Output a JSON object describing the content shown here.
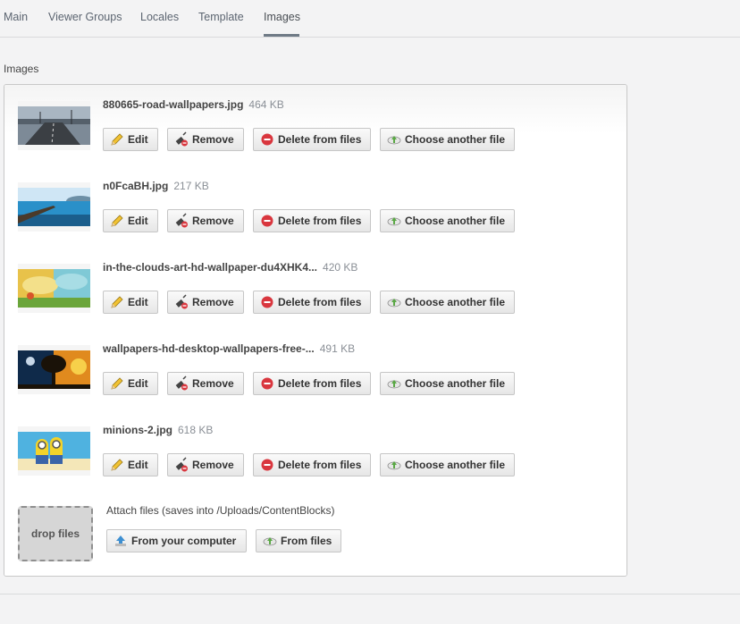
{
  "tabs": [
    {
      "label": "Main"
    },
    {
      "label": "Viewer Groups"
    },
    {
      "label": "Locales"
    },
    {
      "label": "Template"
    },
    {
      "label": "Images"
    }
  ],
  "active_tab": "Images",
  "section_label": "Images",
  "buttons": {
    "edit": "Edit",
    "remove": "Remove",
    "delete": "Delete from files",
    "choose": "Choose another file"
  },
  "files": [
    {
      "name": "880665-road-wallpapers.jpg",
      "size": "464 KB",
      "thumb": "road-thumbnail"
    },
    {
      "name": "n0FcaBH.jpg",
      "size": "217 KB",
      "thumb": "pier-thumbnail"
    },
    {
      "name": "in-the-clouds-art-hd-wallpaper-du4XHK4...",
      "size": "420 KB",
      "thumb": "clouds-art-thumbnail"
    },
    {
      "name": "wallpapers-hd-desktop-wallpapers-free-...",
      "size": "491 KB",
      "thumb": "tree-sunset-thumbnail"
    },
    {
      "name": "minions-2.jpg",
      "size": "618 KB",
      "thumb": "minions-thumbnail"
    }
  ],
  "attach": {
    "drop_label": "drop files",
    "label": "Attach files (saves into /Uploads/ContentBlocks)",
    "from_computer": "From your computer",
    "from_files": "From files"
  },
  "colors": {
    "delete_icon": "#d9363e",
    "cloud_icon_green": "#5aa845",
    "upload_icon_blue": "#3d8fd1",
    "active_tab_underline": "#6f7a86"
  }
}
